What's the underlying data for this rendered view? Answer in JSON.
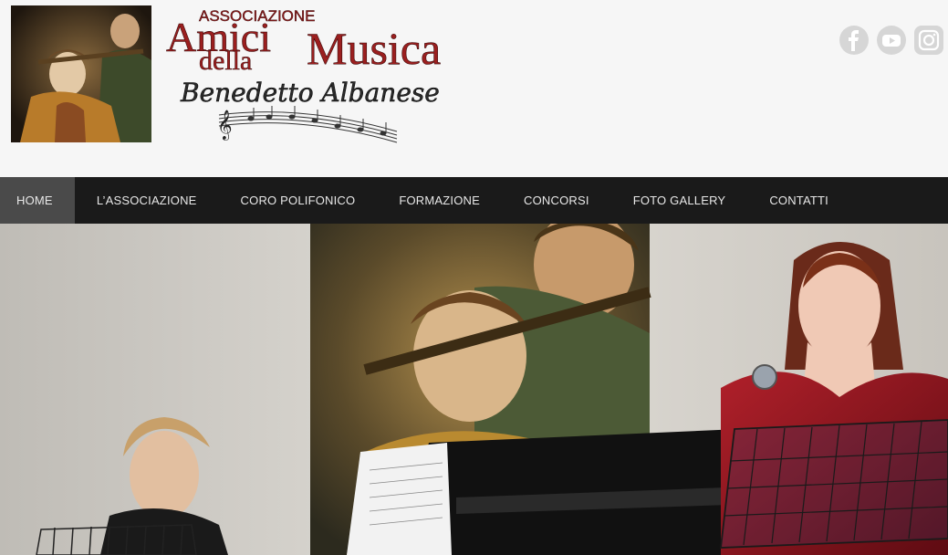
{
  "header": {
    "logo": {
      "line1": "ASSOCIAZIONE",
      "line2a": "Amici",
      "line2b": "Musica",
      "line2c": "della",
      "line3": "Benedetto Albanese"
    },
    "social": [
      {
        "name": "facebook",
        "icon": "facebook-icon"
      },
      {
        "name": "youtube",
        "icon": "youtube-icon"
      },
      {
        "name": "instagram",
        "icon": "instagram-icon"
      }
    ]
  },
  "nav": {
    "items": [
      {
        "label": "HOME",
        "active": true
      },
      {
        "label": "L’ASSOCIAZIONE"
      },
      {
        "label": "CORO POLIFONICO"
      },
      {
        "label": "FORMAZIONE"
      },
      {
        "label": "CONCORSI"
      },
      {
        "label": "FOTO GALLERY"
      },
      {
        "label": "CONTATTI"
      }
    ]
  },
  "colors": {
    "nav_bg": "#1a1a1a",
    "nav_active": "#4a4a4a",
    "logo_red": "#8b1a1a",
    "social_grey": "#d6d6d6"
  }
}
